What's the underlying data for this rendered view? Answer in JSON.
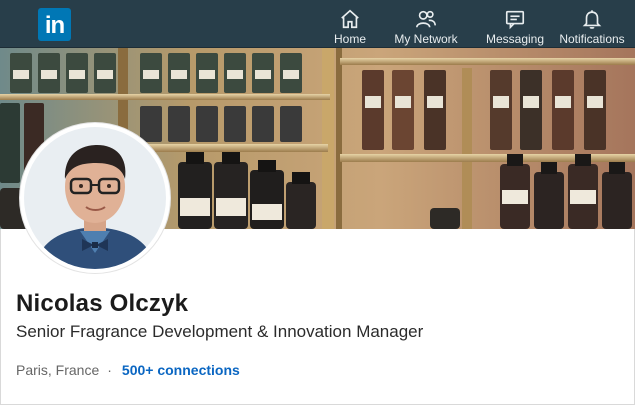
{
  "navbar": {
    "logo_text": "in",
    "items": [
      {
        "label": "Home",
        "icon": "home-icon"
      },
      {
        "label": "My Network",
        "icon": "network-icon"
      },
      {
        "label": "Messaging",
        "icon": "messaging-icon"
      },
      {
        "label": "Notifications",
        "icon": "bell-icon"
      }
    ]
  },
  "profile": {
    "name": "Nicolas Olczyk",
    "headline": "Senior Fragrance Development & Innovation Manager",
    "location": "Paris, France",
    "separator": "·",
    "connections": "500+ connections"
  },
  "colors": {
    "navbar_bg": "#283e4a",
    "brand_blue": "#0077b5",
    "link_blue": "#0a66c2"
  }
}
